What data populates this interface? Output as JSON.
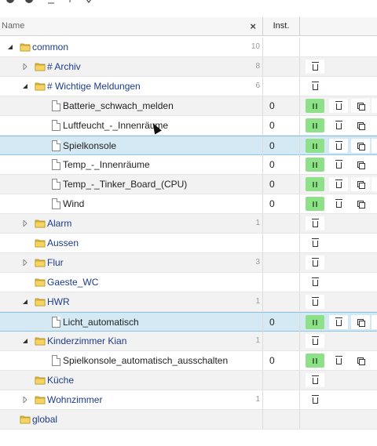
{
  "header": {
    "name_col": "Name",
    "clear_icon": "×",
    "inst_col": "Inst."
  },
  "toolbar": [
    "refresh-icon",
    "info-icon",
    "sort-icon",
    "collapse-icon",
    "expand-icon"
  ],
  "colors": {
    "selected": "#d5e9f5",
    "folder": "#1d3b8c",
    "pause_btn": "#8ee089"
  },
  "rows": [
    {
      "type": "folder",
      "label": "common",
      "level": 0,
      "expanded": true,
      "count": "10"
    },
    {
      "type": "folder",
      "label": "# Archiv",
      "level": 1,
      "expanded": false,
      "count": "8",
      "actions": [
        "delete"
      ]
    },
    {
      "type": "folder",
      "label": "# Wichtige Meldungen",
      "level": 1,
      "expanded": true,
      "count": "6",
      "actions": [
        "delete"
      ]
    },
    {
      "type": "script",
      "label": "Batterie_schwach_melden",
      "level": 2,
      "inst": "0",
      "actions": [
        "pause",
        "delete",
        "copy",
        "more"
      ]
    },
    {
      "type": "script",
      "label": "Luftfeucht_-_Innenräume",
      "level": 2,
      "inst": "0",
      "actions": [
        "pause",
        "delete",
        "copy",
        "more"
      ]
    },
    {
      "type": "script",
      "label": "Spielkonsole",
      "level": 2,
      "inst": "0",
      "selected": true,
      "actions": [
        "pause",
        "delete",
        "copy",
        "more"
      ]
    },
    {
      "type": "script",
      "label": "Temp_-_Innenräume",
      "level": 2,
      "inst": "0",
      "actions": [
        "pause",
        "delete",
        "copy",
        "more"
      ]
    },
    {
      "type": "script",
      "label": "Temp_-_Tinker_Board_(CPU)",
      "level": 2,
      "inst": "0",
      "actions": [
        "pause",
        "delete",
        "copy",
        "more"
      ]
    },
    {
      "type": "script",
      "label": "Wind",
      "level": 2,
      "inst": "0",
      "actions": [
        "pause",
        "delete",
        "copy",
        "more"
      ]
    },
    {
      "type": "folder",
      "label": "Alarm",
      "level": 1,
      "expanded": false,
      "count": "1",
      "actions": [
        "delete"
      ]
    },
    {
      "type": "folder",
      "label": "Aussen",
      "level": 1,
      "count": "",
      "actions": [
        "delete"
      ]
    },
    {
      "type": "folder",
      "label": "Flur",
      "level": 1,
      "expanded": false,
      "count": "3",
      "actions": [
        "delete"
      ]
    },
    {
      "type": "folder",
      "label": "Gaeste_WC",
      "level": 1,
      "count": "",
      "actions": [
        "delete"
      ]
    },
    {
      "type": "folder",
      "label": "HWR",
      "level": 1,
      "expanded": true,
      "count": "1",
      "actions": [
        "delete"
      ]
    },
    {
      "type": "script",
      "label": "Licht_automatisch",
      "level": 2,
      "inst": "0",
      "selected": true,
      "actions": [
        "pause",
        "delete",
        "copy",
        "more"
      ]
    },
    {
      "type": "folder",
      "label": "Kinderzimmer Kian",
      "level": 1,
      "expanded": true,
      "count": "1",
      "actions": [
        "delete"
      ]
    },
    {
      "type": "script",
      "label": "Spielkonsole_automatisch_ausschalten",
      "level": 2,
      "inst": "0",
      "actions": [
        "pause",
        "delete",
        "copy",
        "more"
      ]
    },
    {
      "type": "folder",
      "label": "Küche",
      "level": 1,
      "count": "",
      "actions": [
        "delete"
      ]
    },
    {
      "type": "folder",
      "label": "Wohnzimmer",
      "level": 1,
      "expanded": false,
      "count": "1",
      "actions": [
        "delete"
      ]
    },
    {
      "type": "folder",
      "label": "global",
      "level": 0,
      "count": ""
    }
  ]
}
